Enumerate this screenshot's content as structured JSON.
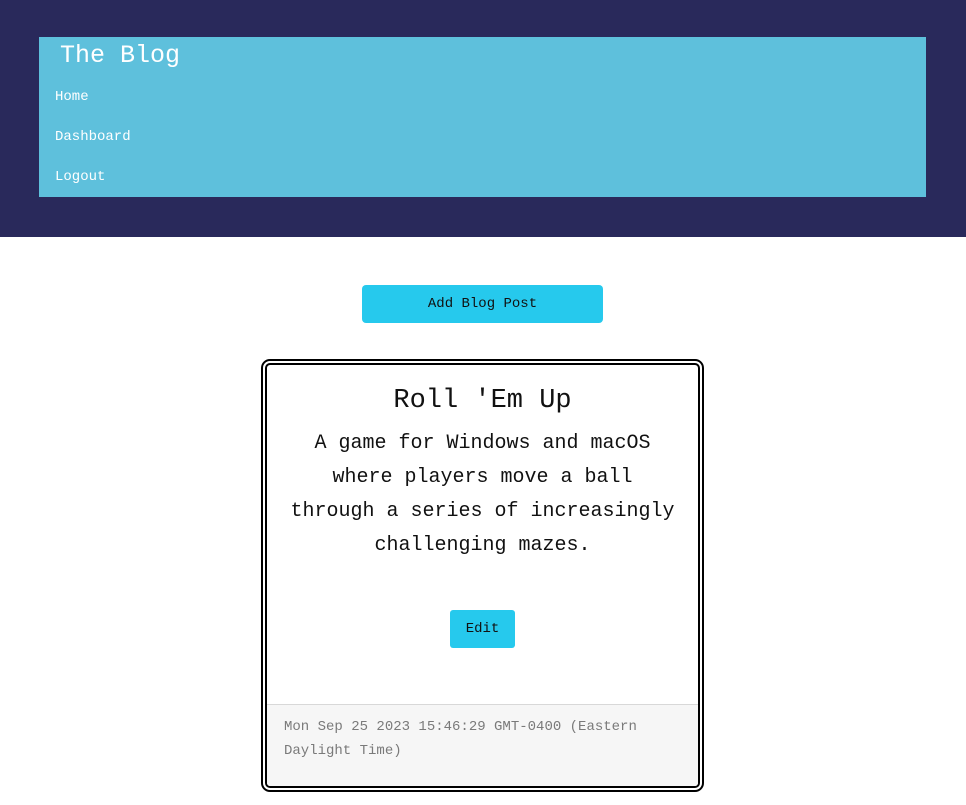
{
  "header": {
    "title": "The Blog",
    "nav": [
      {
        "label": "Home"
      },
      {
        "label": "Dashboard"
      },
      {
        "label": "Logout"
      }
    ]
  },
  "main": {
    "add_button_label": "Add Blog Post",
    "posts": [
      {
        "title": "Roll 'Em Up",
        "body": "A game for Windows and macOS where players move a ball through a series of increasingly challenging mazes.",
        "edit_label": "Edit",
        "date": "Mon Sep 25 2023 15:46:29 GMT-0400 (Eastern Daylight Time)"
      }
    ]
  },
  "colors": {
    "header_bg": "#29295b",
    "nav_bg": "#5ec0dc",
    "button_bg": "#26c9ed"
  }
}
